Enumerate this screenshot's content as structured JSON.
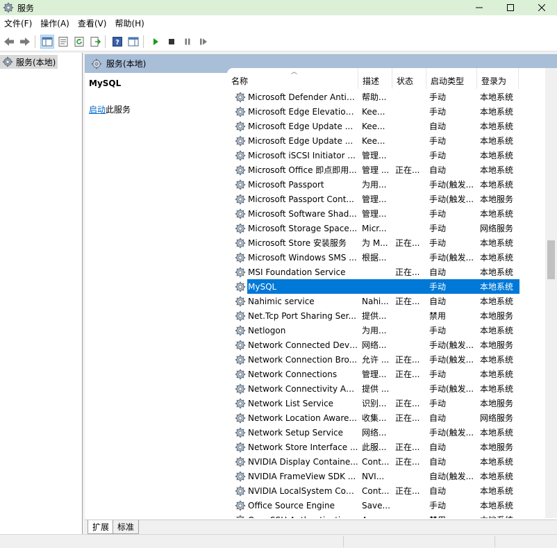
{
  "window": {
    "title": "服务"
  },
  "menu": [
    "文件(F)",
    "操作(A)",
    "查看(V)",
    "帮助(H)"
  ],
  "tree": {
    "root": "服务(本地)"
  },
  "pane": {
    "header": "服务(本地)"
  },
  "detail": {
    "service_name": "MySQL",
    "action_link": "启动",
    "action_suffix": "此服务"
  },
  "columns": {
    "name": "名称",
    "desc": "描述",
    "status": "状态",
    "startup": "启动类型",
    "logon": "登录为"
  },
  "services": [
    {
      "name": "Microsoft Defender Antiv...",
      "desc": "帮助...",
      "status": "",
      "startup": "手动",
      "logon": "本地系统"
    },
    {
      "name": "Microsoft Edge Elevation...",
      "desc": "Kee...",
      "status": "",
      "startup": "手动",
      "logon": "本地系统"
    },
    {
      "name": "Microsoft Edge Update ...",
      "desc": "Kee...",
      "status": "",
      "startup": "自动",
      "logon": "本地系统"
    },
    {
      "name": "Microsoft Edge Update ...",
      "desc": "Kee...",
      "status": "",
      "startup": "手动",
      "logon": "本地系统"
    },
    {
      "name": "Microsoft iSCSI Initiator ...",
      "desc": "管理...",
      "status": "",
      "startup": "手动",
      "logon": "本地系统"
    },
    {
      "name": "Microsoft Office 即点即用...",
      "desc": "管理 ...",
      "status": "正在...",
      "startup": "自动",
      "logon": "本地系统"
    },
    {
      "name": "Microsoft Passport",
      "desc": "为用...",
      "status": "",
      "startup": "手动(触发...",
      "logon": "本地系统"
    },
    {
      "name": "Microsoft Passport Cont...",
      "desc": "管理...",
      "status": "",
      "startup": "手动(触发...",
      "logon": "本地服务"
    },
    {
      "name": "Microsoft Software Shad...",
      "desc": "管理...",
      "status": "",
      "startup": "手动",
      "logon": "本地系统"
    },
    {
      "name": "Microsoft Storage Space...",
      "desc": "Micr...",
      "status": "",
      "startup": "手动",
      "logon": "网络服务"
    },
    {
      "name": "Microsoft Store 安装服务",
      "desc": "为 M...",
      "status": "正在...",
      "startup": "手动",
      "logon": "本地系统"
    },
    {
      "name": "Microsoft Windows SMS ...",
      "desc": "根据...",
      "status": "",
      "startup": "手动(触发...",
      "logon": "本地系统"
    },
    {
      "name": "MSI Foundation Service",
      "desc": "",
      "status": "正在...",
      "startup": "自动",
      "logon": "本地系统"
    },
    {
      "name": "MySQL",
      "desc": "",
      "status": "",
      "startup": "手动",
      "logon": "本地系统",
      "selected": true
    },
    {
      "name": "Nahimic service",
      "desc": "Nahi...",
      "status": "正在...",
      "startup": "自动",
      "logon": "本地系统"
    },
    {
      "name": "Net.Tcp Port Sharing Ser...",
      "desc": "提供...",
      "status": "",
      "startup": "禁用",
      "logon": "本地服务"
    },
    {
      "name": "Netlogon",
      "desc": "为用...",
      "status": "",
      "startup": "手动",
      "logon": "本地系统"
    },
    {
      "name": "Network Connected Devi...",
      "desc": "网络...",
      "status": "",
      "startup": "手动(触发...",
      "logon": "本地服务"
    },
    {
      "name": "Network Connection Bro...",
      "desc": "允许 ...",
      "status": "正在...",
      "startup": "手动(触发...",
      "logon": "本地系统"
    },
    {
      "name": "Network Connections",
      "desc": "管理...",
      "status": "正在...",
      "startup": "手动",
      "logon": "本地系统"
    },
    {
      "name": "Network Connectivity Ass...",
      "desc": "提供 ...",
      "status": "",
      "startup": "手动(触发...",
      "logon": "本地系统"
    },
    {
      "name": "Network List Service",
      "desc": "识别...",
      "status": "正在...",
      "startup": "手动",
      "logon": "本地服务"
    },
    {
      "name": "Network Location Aware...",
      "desc": "收集...",
      "status": "正在...",
      "startup": "自动",
      "logon": "网络服务"
    },
    {
      "name": "Network Setup Service",
      "desc": "网络...",
      "status": "",
      "startup": "手动(触发...",
      "logon": "本地系统"
    },
    {
      "name": "Network Store Interface ...",
      "desc": "此服...",
      "status": "正在...",
      "startup": "自动",
      "logon": "本地服务"
    },
    {
      "name": "NVIDIA Display Containe...",
      "desc": "Cont...",
      "status": "正在...",
      "startup": "自动",
      "logon": "本地系统"
    },
    {
      "name": "NVIDIA FrameView SDK ...",
      "desc": "NVI...",
      "status": "",
      "startup": "自动(触发...",
      "logon": "本地系统"
    },
    {
      "name": "NVIDIA LocalSystem Con...",
      "desc": "Cont...",
      "status": "正在...",
      "startup": "自动",
      "logon": "本地系统"
    },
    {
      "name": "Office  Source Engine",
      "desc": "Save...",
      "status": "",
      "startup": "手动",
      "logon": "本地系统"
    },
    {
      "name": "OpenSSH Authentication ...",
      "desc": "A...",
      "status": "",
      "startup": "禁用",
      "logon": "本地系统"
    }
  ],
  "tabs": [
    "扩展",
    "标准"
  ],
  "colors": {
    "titlebar": "#dcf0d8",
    "pane_header": "#a9bed7",
    "selection": "#0078d7",
    "link": "#0066cc"
  }
}
